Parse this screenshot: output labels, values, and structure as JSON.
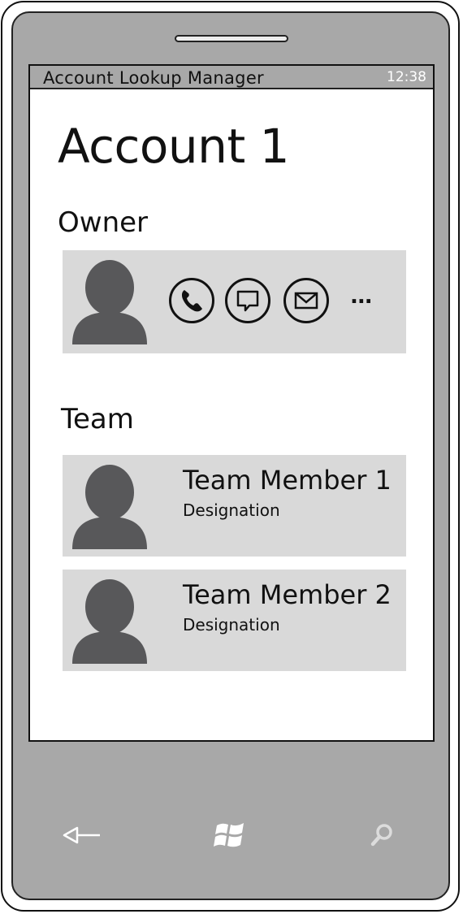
{
  "status_bar": {
    "app_title": "Account Lookup Manager",
    "clock": "12:38"
  },
  "page": {
    "title": "Account 1"
  },
  "owner": {
    "section_label": "Owner",
    "actions": {
      "call_icon": "phone-icon",
      "message_icon": "chat-bubble-icon",
      "email_icon": "envelope-icon",
      "more_label": "..."
    }
  },
  "team": {
    "section_label": "Team",
    "members": [
      {
        "name": "Team Member  1",
        "designation": "Designation"
      },
      {
        "name": "Team Member  2",
        "designation": "Designation"
      }
    ]
  },
  "nav_bar": {
    "back_icon": "back-arrow-icon",
    "start_icon": "windows-logo-icon",
    "search_icon": "search-icon"
  },
  "colors": {
    "phone_body": "#a8a8a8",
    "card_background": "#d9d9d9",
    "avatar": "#58585a",
    "nav_icon": "#ffffff"
  }
}
